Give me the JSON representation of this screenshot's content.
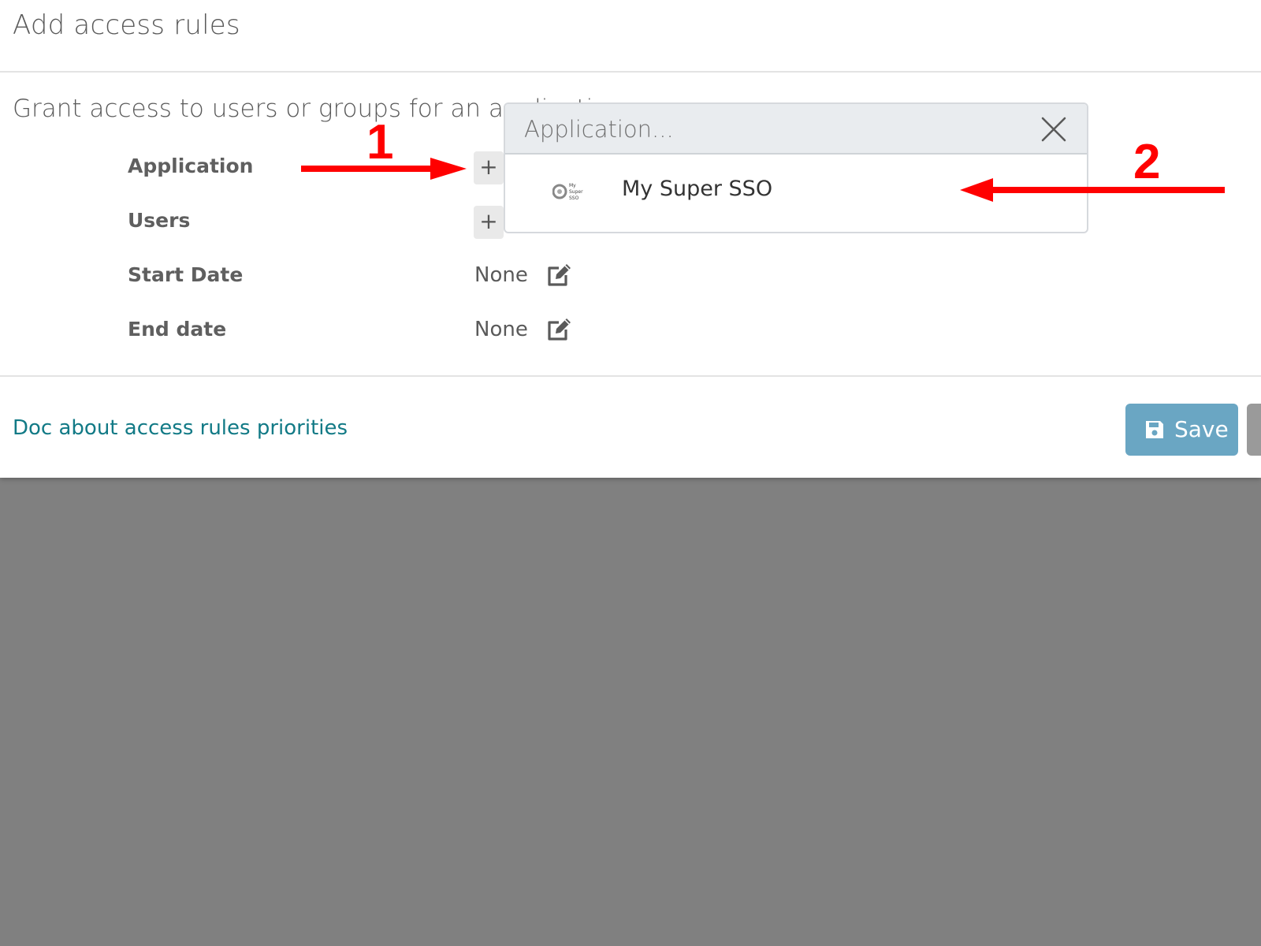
{
  "modal": {
    "title": "Add access rules",
    "intro": "Grant access to users or groups for an application"
  },
  "form": {
    "fields": [
      {
        "label": "Application"
      },
      {
        "label": "Users"
      },
      {
        "label": "Start Date",
        "value": "None"
      },
      {
        "label": "End date",
        "value": "None"
      }
    ],
    "add_symbol": "+"
  },
  "dropdown": {
    "placeholder": "Application...",
    "options": [
      {
        "label": "My Super SSO",
        "logo_text": [
          "My",
          "Super",
          "SSO"
        ]
      }
    ]
  },
  "footer": {
    "doc_link": "Doc about access rules priorities",
    "save_label": "Save"
  },
  "annotations": {
    "step1": "1",
    "step2": "2",
    "color": "#ff0000"
  },
  "colors": {
    "link": "#127a86",
    "save_button": "#6aa6c3",
    "overlay": "#808080"
  }
}
